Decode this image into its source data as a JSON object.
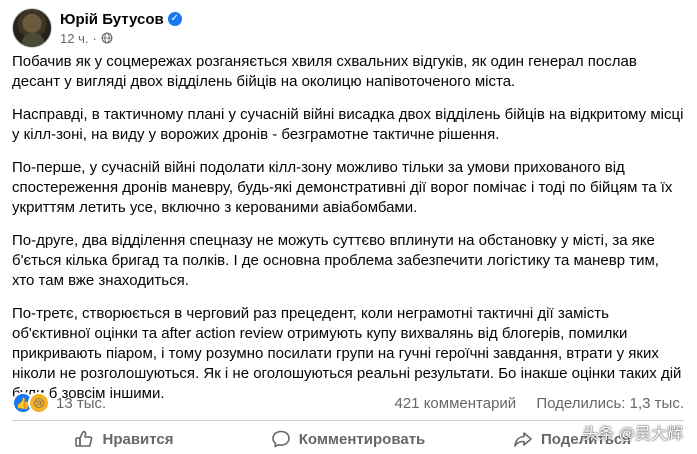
{
  "post": {
    "author": "Юрій Бутусов",
    "time": "12 ч.",
    "paragraphs": [
      "Побачив як у соцмережах розганяється хвиля схвальних відгуків, як один генерал послав десант у вигляді двох відділень бійців на околицю напівоточеного міста.",
      "Насправді, в тактичному плані у сучасній війні висадка двох відділень бійців на відкритому місці у кілл-зоні, на виду у ворожих дронів - безграмотне тактичне рішення.",
      "По-перше, у сучасній війні подолати кілл-зону можливо тільки за умови прихованого від спостереження дронів маневру, будь-які демонстративні дії ворог помічає і тоді по бійцям та їх укриттям летить усе, включно з керованими авіабомбами.",
      "По-друге, два відділення спецназу не можуть суттєво вплинути на обстановку у місті, за яке б'ється кілька бригад та полків. І де основна проблема забезпечити логістику та маневр тим, хто там вже знаходиться.",
      "По-третє, створюється в черговий раз прецедент, коли неграмотні тактичні дії замість об'єктивної оцінки та after action review отримують купу вихвалянь від  блогерів, помилки прикривають піаром, і тому розумно посилати групи на гучні героїчні завдання, втрати у яких ніколи не розголошуються. Як і не оголошуються реальні результати. Бо інакше оцінки таких дій були б зовсім іншими."
    ]
  },
  "stats": {
    "reactions": "13 тыс.",
    "comments": "421 комментарий",
    "shares": "Поделились: 1,3 тыс."
  },
  "actions": {
    "like": "Нравится",
    "comment": "Комментировать",
    "share": "Поделиться"
  },
  "watermark": "头条 @吴大辉",
  "icons": [
    "verified-badge-icon",
    "globe-icon",
    "like-reaction-icon",
    "sad-reaction-icon",
    "thumbs-up-icon",
    "comment-icon",
    "share-icon"
  ],
  "colors": {
    "accent": "#1877f2",
    "muted_text": "#65676b",
    "sad_reaction": "#f7b125",
    "divider": "#ced0d4"
  }
}
